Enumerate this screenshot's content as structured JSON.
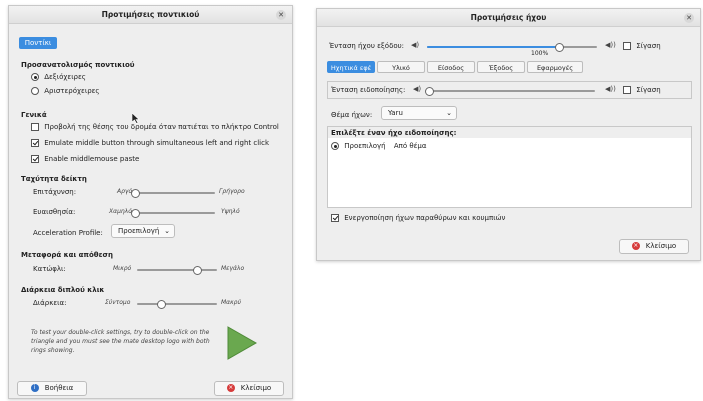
{
  "mouse": {
    "title": "Προτιμήσεις ποντικιού",
    "tab": "Ποντίκι",
    "orientation": {
      "heading": "Προσανατολισμός ποντικιού",
      "right": "Δεξιόχειρες",
      "left": "Αριστερόχειρες"
    },
    "general": {
      "heading": "Γενικά",
      "show_position": "Προβολή της θέσης του δρομέα όταν πατιέται το πλήκτρο Control",
      "emulate_middle": "Emulate middle button through simultaneous left and right click",
      "middle_paste": "Enable middlemouse paste"
    },
    "speed": {
      "heading": "Ταχύτητα δείκτη",
      "accel_label": "Επιτάχυνση:",
      "accel_min": "Αργό",
      "accel_max": "Γρήγορο",
      "accel_level": 0.0,
      "sens_label": "Ευαισθησία:",
      "sens_min": "Χαμηλό",
      "sens_max": "Υψηλό",
      "sens_level": 0.0,
      "profile_label": "Acceleration Profile:",
      "profile_value": "Προεπιλογή"
    },
    "drag": {
      "heading": "Μεταφορά και απόθεση",
      "threshold_label": "Κατώφλι:",
      "min": "Μικρό",
      "max": "Μεγάλο",
      "level": 0.75
    },
    "dblclick": {
      "heading": "Διάρκεια διπλού κλικ",
      "label": "Διάρκεια:",
      "min": "Σύντομο",
      "max": "Μακρύ",
      "level": 0.3,
      "help": "To test your double-click settings, try to double-click on the triangle and you must see the mate desktop logo with both rings showing."
    },
    "help_button": "Βοήθεια",
    "close_button": "Κλείσιμο"
  },
  "sound": {
    "title": "Προτιμήσεις ήχου",
    "output_volume_label": "Ένταση ήχου εξόδου:",
    "output_volume": "100%",
    "output_level": 0.78,
    "mute": "Σίγαση",
    "tabs": [
      "Ηχητικά εφέ",
      "Υλικό",
      "Είσοδος",
      "Έξοδος",
      "Εφαρμογές"
    ],
    "alert_volume_label": "Ένταση ειδοποίησης:",
    "alert_level": 0.0,
    "theme_label": "Θέμα ήχων:",
    "theme_value": "Yaru",
    "choose_alert": "Επιλέξτε έναν ήχο ειδοποίησης:",
    "alert_option": "Προεπιλογή",
    "alert_option_from": "Από θέμα",
    "enable_window_sounds": "Ενεργοποίηση ήχων παραθύρων και κουμπιών",
    "close_button": "Κλείσιμο"
  }
}
